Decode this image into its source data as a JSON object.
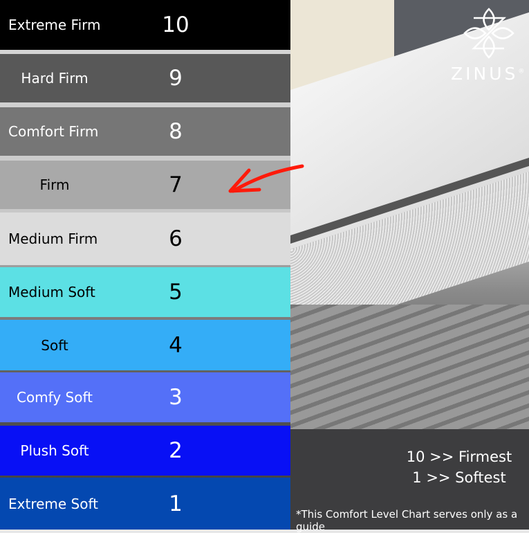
{
  "chart": {
    "levels": [
      {
        "label": "Extreme Firm",
        "value": "10",
        "color": "#000000",
        "text_color": "#ffffff"
      },
      {
        "label": "Hard Firm",
        "value": "9",
        "color": "#585858",
        "text_color": "#ffffff"
      },
      {
        "label": "Comfort Firm",
        "value": "8",
        "color": "#767676",
        "text_color": "#ffffff"
      },
      {
        "label": "Firm",
        "value": "7",
        "color": "#a9a9a9",
        "text_color": "#000000"
      },
      {
        "label": "Medium Firm",
        "value": "6",
        "color": "#dcdcdc",
        "text_color": "#000000"
      },
      {
        "label": "Medium Soft",
        "value": "5",
        "color": "#5ce0e4",
        "text_color": "#000000"
      },
      {
        "label": "Soft",
        "value": "4",
        "color": "#34adf7",
        "text_color": "#000000"
      },
      {
        "label": "Comfy Soft",
        "value": "3",
        "color": "#5470f8",
        "text_color": "#ffffff"
      },
      {
        "label": "Plush Soft",
        "value": "2",
        "color": "#0810f5",
        "text_color": "#ffffff"
      },
      {
        "label": "Extreme Soft",
        "value": "1",
        "color": "#0448b0",
        "text_color": "#ffffff"
      }
    ],
    "highlighted_value": "7",
    "highlight_color": "#ff1a0a"
  },
  "brand": {
    "name": "ZINUS",
    "registered": "®"
  },
  "legend": {
    "firmest": "10 >>  Firmest",
    "softest": "1 >>  Softest"
  },
  "note": "*This Comfort Level Chart serves only as a guide"
}
